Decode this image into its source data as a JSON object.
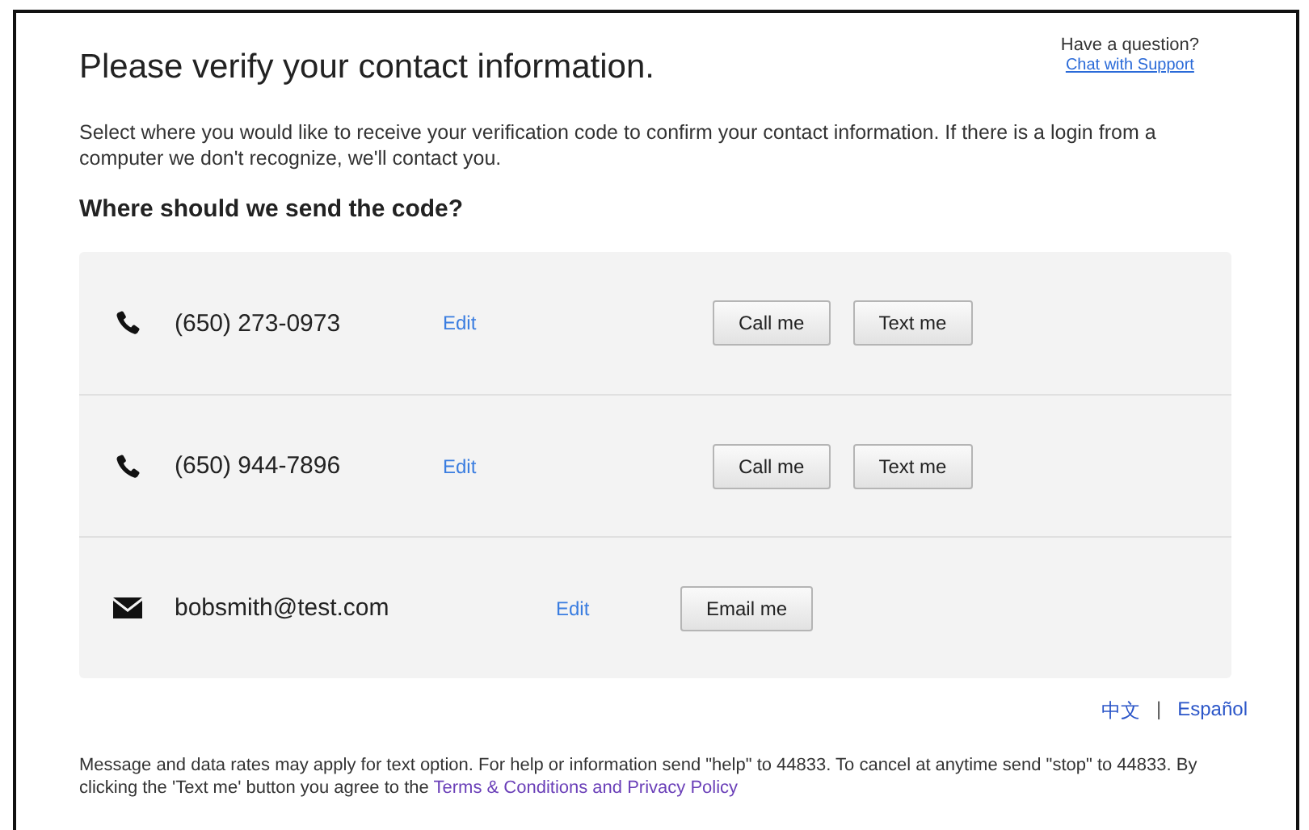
{
  "title": "Please verify your contact information.",
  "help": {
    "question": "Have a question?",
    "link": "Chat with Support"
  },
  "intro": "Select where you would like to receive your verification code to confirm your contact information. If there is a login from a computer we don't recognize, we'll contact you.",
  "heading": "Where should we send the code?",
  "contacts": [
    {
      "kind": "phone",
      "value": "(650) 273-0973",
      "edit": "Edit",
      "buttons": [
        "Call me",
        "Text me"
      ]
    },
    {
      "kind": "phone",
      "value": "(650) 944-7896",
      "edit": "Edit",
      "buttons": [
        "Call me",
        "Text me"
      ]
    },
    {
      "kind": "email",
      "value": "bobsmith@test.com",
      "edit": "Edit",
      "buttons": [
        "Email me"
      ]
    }
  ],
  "languages": [
    "中文",
    "Español"
  ],
  "language_separator": "|",
  "footer": {
    "text": "Message and data rates may apply for text option. For help or information send \"help\" to 44833. To cancel at anytime send \"stop\" to 44833. By clicking the 'Text me' button you agree to the",
    "link": "Terms & Conditions and Privacy Policy"
  }
}
